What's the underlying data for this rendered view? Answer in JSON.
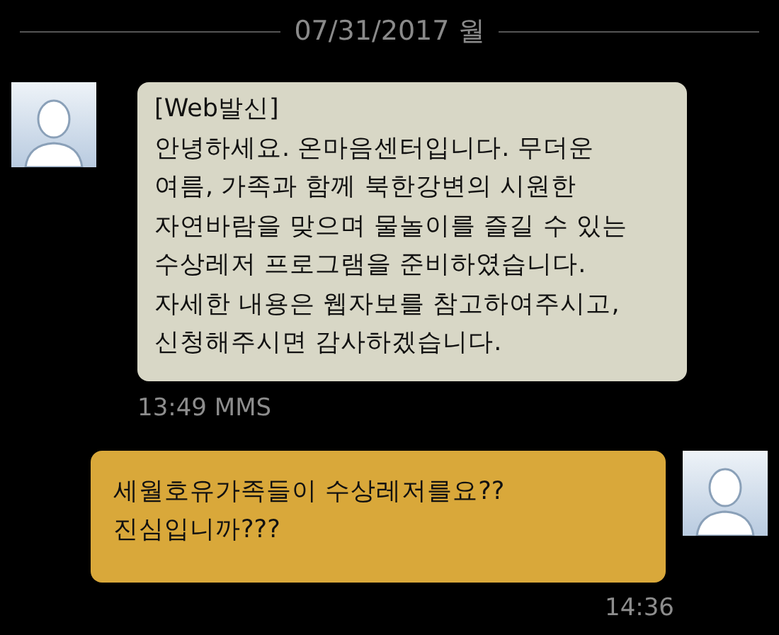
{
  "date_header": "07/31/2017 월",
  "messages": [
    {
      "kind": "received",
      "text": "[Web발신]\n안녕하세요. 온마음센터입니다. 무더운\n여름, 가족과 함께 북한강변의 시원한\n자연바람을 맞으며 물놀이를 즐길 수 있는\n수상레저 프로그램을 준비하였습니다.\n자세한 내용은 웹자보를 참고하여주시고,\n신청해주시면 감사하겠습니다.",
      "time": "13:49 MMS"
    },
    {
      "kind": "sent",
      "text": "세월호유가족들이 수상레저를요??\n진심입니까???",
      "time": "14:36"
    }
  ]
}
